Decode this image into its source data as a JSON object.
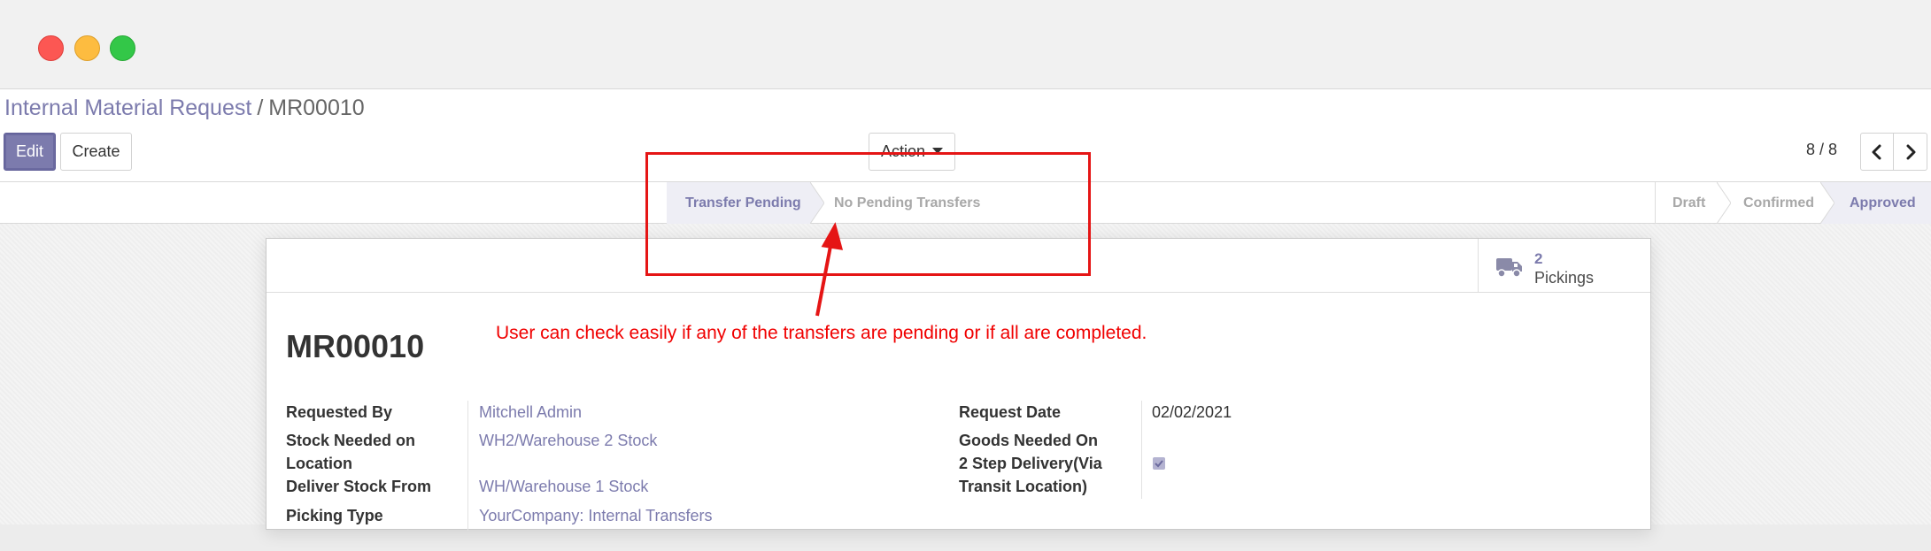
{
  "window": {
    "controls": [
      "close",
      "minimize",
      "zoom"
    ]
  },
  "breadcrumb": {
    "parent": "Internal Material Request",
    "separator": "/",
    "current": "MR00010"
  },
  "toolbar": {
    "edit_label": "Edit",
    "create_label": "Create",
    "action_label": "Action"
  },
  "pager": {
    "value": "8 / 8",
    "prev_icon": "chevron-left-icon",
    "next_icon": "chevron-right-icon"
  },
  "transfer_status": {
    "stages": [
      "Transfer Pending",
      "No Pending Transfers"
    ],
    "active": "Transfer Pending"
  },
  "state_bar": {
    "stages": [
      "Draft",
      "Confirmed",
      "Approved"
    ],
    "active": "Approved"
  },
  "smart_button": {
    "icon": "truck-icon",
    "count": "2",
    "label": "Pickings"
  },
  "record": {
    "name": "MR00010"
  },
  "fields_left": [
    {
      "label": "Requested By",
      "value": "Mitchell Admin"
    },
    {
      "label_line1": "Stock Needed on",
      "label_line2": "Location",
      "value": "WH2/Warehouse 2 Stock"
    },
    {
      "label": "Deliver Stock From",
      "value": "WH/Warehouse 1 Stock"
    },
    {
      "label": "Picking Type",
      "value": "YourCompany: Internal Transfers"
    }
  ],
  "fields_right": [
    {
      "label": "Request Date",
      "value": "02/02/2021"
    },
    {
      "label": "Goods Needed On",
      "value": ""
    },
    {
      "label_line1": "2 Step Delivery(Via",
      "label_line2": "Transit Location)",
      "checked": true
    }
  ],
  "annotation": {
    "text": "User can check easily if any of the transfers are pending or if all are completed.",
    "color": "#e51515"
  },
  "colors": {
    "brand": "#7c7bad",
    "annotation": "#e51515"
  }
}
